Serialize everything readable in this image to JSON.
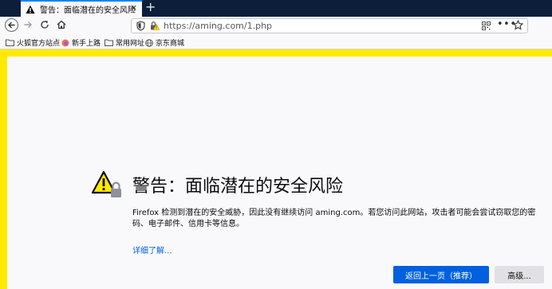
{
  "tab": {
    "title": "警告：面临潜在的安全风险",
    "close_glyph": "✕",
    "new_tab_glyph": "+"
  },
  "toolbar": {
    "url": "https://aming.com/1.php",
    "more_glyph": "•••"
  },
  "bookmarks": {
    "items": [
      {
        "label": "火狐官方站点",
        "icon": "folder-icon"
      },
      {
        "label": "新手上路",
        "icon": "firefox-icon"
      },
      {
        "label": "常用网址",
        "icon": "folder-icon"
      },
      {
        "label": "京东商城",
        "icon": "globe-icon"
      }
    ]
  },
  "page": {
    "heading": "警告：面临潜在的安全风险",
    "description": "Firefox 检测到潜在的安全威胁，因此没有继续访问 aming.com。若您访问此网站，攻击者可能会尝试窃取您的密码、电子邮件、信用卡等信息。",
    "learn_more": "详细了解...",
    "go_back_button": "返回上一页（推荐）",
    "advanced_button": "高级..."
  },
  "colors": {
    "warning_stripe": "#ffe900",
    "primary_button": "#0060df",
    "link": "#0060df",
    "tab_strip": "#0c1e3a"
  }
}
